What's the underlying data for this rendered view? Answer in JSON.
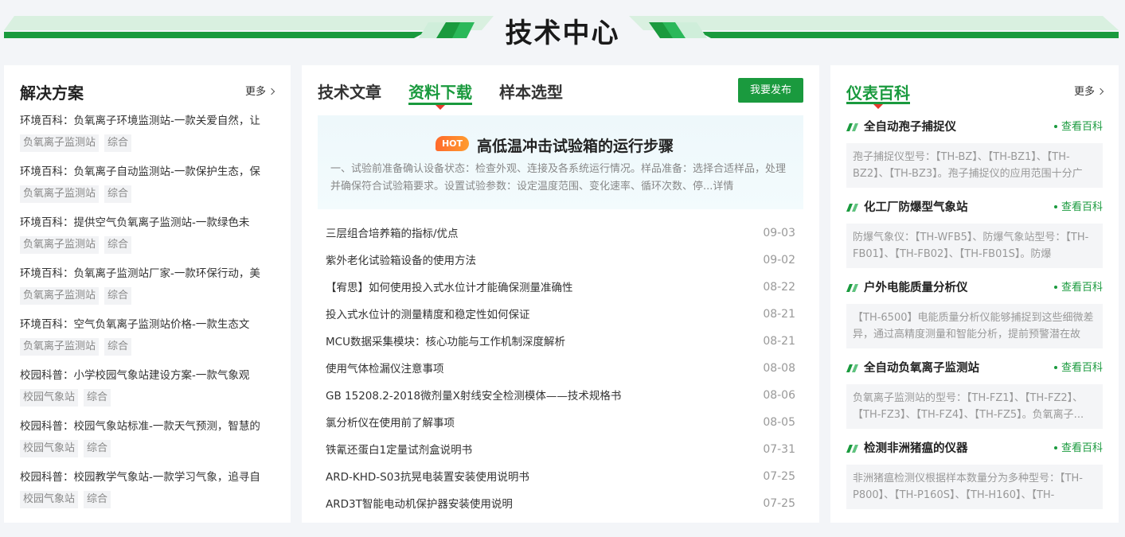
{
  "banner": {
    "title": "技术中心"
  },
  "solutions": {
    "title": "解决方案",
    "more": "更多",
    "items": [
      {
        "title": "环境百科：负氧离子环境监测站-一款关爱自然，让",
        "tags": [
          "负氧离子监测站",
          "综合"
        ]
      },
      {
        "title": "环境百科：负氧离子自动监测站-一款保护生态，保",
        "tags": [
          "负氧离子监测站",
          "综合"
        ]
      },
      {
        "title": "环境百科：提供空气负氧离子监测站-一款绿色未",
        "tags": [
          "负氧离子监测站",
          "综合"
        ]
      },
      {
        "title": "环境百科：负氧离子监测站厂家-一款环保行动，美",
        "tags": [
          "负氧离子监测站",
          "综合"
        ]
      },
      {
        "title": "环境百科：空气负氧离子监测站价格-一款生态文",
        "tags": [
          "负氧离子监测站",
          "综合"
        ]
      },
      {
        "title": "校园科普：小学校园气象站建设方案-一款气象观",
        "tags": [
          "校园气象站",
          "综合"
        ]
      },
      {
        "title": "校园科普：校园气象站标准-一款天气预测，智慧的",
        "tags": [
          "校园气象站",
          "综合"
        ]
      },
      {
        "title": "校园科普：校园教学气象站-一款学习气象，追寻自",
        "tags": [
          "校园气象站",
          "综合"
        ]
      }
    ]
  },
  "middle": {
    "tabs": [
      {
        "label": "技术文章",
        "active": false
      },
      {
        "label": "资料下载",
        "active": true
      },
      {
        "label": "样本选型",
        "active": false
      }
    ],
    "publish_label": "我要发布",
    "featured": {
      "badge": "HOT",
      "title": "高低温冲击试验箱的运行步骤",
      "desc": "一、试验前准备确认设备状态：检查外观、连接及各系统运行情况。样品准备：选择合适样品，处理并确保符合试验箱要求。设置试验参数：设定温度范围、变化速率、循环次数、停...详情"
    },
    "articles": [
      {
        "title": "三层组合培养箱的指标/优点",
        "date": "09-03"
      },
      {
        "title": "紫外老化试验箱设备的使用方法",
        "date": "09-02"
      },
      {
        "title": "【宥思】如何使用投入式水位计才能确保测量准确性",
        "date": "08-22"
      },
      {
        "title": "投入式水位计的测量精度和稳定性如何保证",
        "date": "08-21"
      },
      {
        "title": "MCU数据采集模块：核心功能与工作机制深度解析",
        "date": "08-21"
      },
      {
        "title": "使用气体检漏仪注意事项",
        "date": "08-08"
      },
      {
        "title": "GB 15208.2-2018微剂量X射线安全检测模体——技术规格书",
        "date": "08-06"
      },
      {
        "title": "氯分析仪在使用前了解事项",
        "date": "08-05"
      },
      {
        "title": "铁氰还蛋白1定量试剂盒说明书",
        "date": "07-31"
      },
      {
        "title": "ARD-KHD-S03抗晃电装置安装使用说明书",
        "date": "07-25"
      },
      {
        "title": "ARD3T智能电动机保护器安装使用说明",
        "date": "07-25"
      }
    ]
  },
  "encyclopedia": {
    "title": "仪表百科",
    "more": "更多",
    "link_label": "查看百科",
    "items": [
      {
        "title": "全自动孢子捕捉仪",
        "desc": "孢子捕捉仪型号：【TH-BZ】、【TH-BZ1】、【TH-BZ2】、【TH-BZ3】。孢子捕捉仪的应用范围十分广"
      },
      {
        "title": "化工厂防爆型气象站",
        "desc": "防爆气象仪：【TH-WFB5】、防爆气象站型号：【TH-FB01】、【TH-FB02】、【TH-FB01S】。防爆"
      },
      {
        "title": "户外电能质量分析仪",
        "desc": "【TH-6500】电能质量分析仪能够捕捉到这些细微差异，通过高精度测量和智能分析，提前预警潜在故"
      },
      {
        "title": "全自动负氧离子监测站",
        "desc": "负氧离子监测站的型号：【TH-FZ1】、【TH-FZ2】、【TH-FZ3】、【TH-FZ4】、【TH-FZ5】。负氧离子..."
      },
      {
        "title": "检测非洲猪瘟的仪器",
        "desc": "非洲猪瘟检测仪根据样本数量分为多种型号：【TH-P800】、【TH-P160S】、【TH-H160】、【TH-"
      }
    ]
  }
}
